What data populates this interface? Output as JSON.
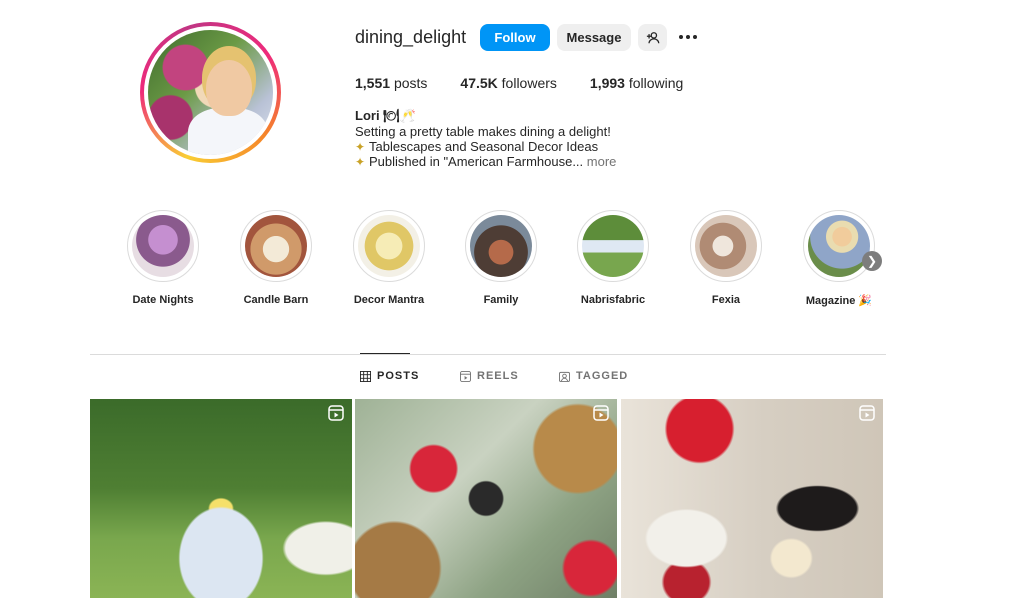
{
  "profile": {
    "username": "dining_delight",
    "follow_label": "Follow",
    "message_label": "Message",
    "stats": {
      "posts_count": "1,551",
      "posts_label": "posts",
      "followers_count": "47.5K",
      "followers_label": "followers",
      "following_count": "1,993",
      "following_label": "following"
    },
    "bio": {
      "name": "Lori 🍽🥂",
      "line1": "Setting a pretty table makes dining a delight!",
      "line2": "Tablescapes and Seasonal Decor Ideas",
      "line3": "Published in \"American Farmhouse...",
      "more": "more"
    }
  },
  "highlights": [
    {
      "label": "Date Nights",
      "color": "#b87ab6"
    },
    {
      "label": "Candle Barn",
      "color": "#c9a56a"
    },
    {
      "label": "Decor Mantra",
      "color": "#e3d27a"
    },
    {
      "label": "Family",
      "color": "#6f5a4e"
    },
    {
      "label": "Nabrisfabric",
      "color": "#6d9b4a"
    },
    {
      "label": "Fexia",
      "color": "#c6a79a"
    },
    {
      "label": "Magazine 🎉",
      "color": "#8fa5c8"
    }
  ],
  "tabs": [
    {
      "label": "POSTS",
      "icon": "grid-icon",
      "active": true
    },
    {
      "label": "REELS",
      "icon": "reels-icon",
      "active": false
    },
    {
      "label": "TAGGED",
      "icon": "tagged-icon",
      "active": false
    }
  ],
  "posts": [
    {
      "type": "reel",
      "subject": "garden table with lemons"
    },
    {
      "type": "reel",
      "subject": "red flowers and lantern"
    },
    {
      "type": "reel",
      "subject": "candle and red flowers"
    }
  ]
}
